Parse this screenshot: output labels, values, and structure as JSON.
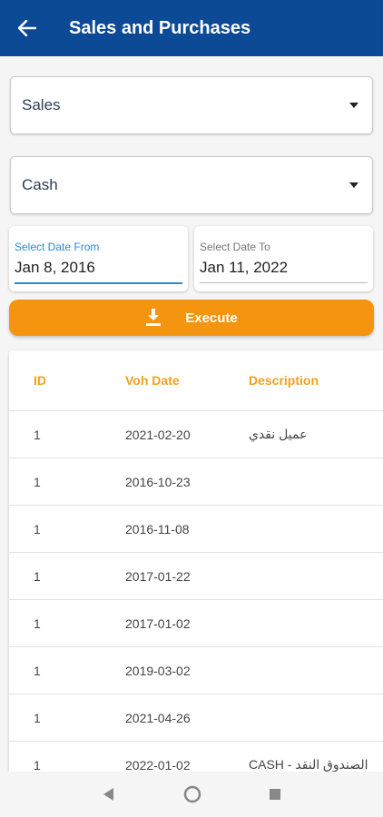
{
  "appbar": {
    "title": "Sales and Purchases"
  },
  "filters": {
    "type_dropdown": "Sales",
    "payment_dropdown": "Cash",
    "date_from": {
      "label": "Select Date From",
      "value": "Jan 8, 2016"
    },
    "date_to": {
      "label": "Select Date To",
      "value": "Jan 11, 2022"
    }
  },
  "execute": {
    "label": "Execute"
  },
  "table": {
    "headers": {
      "id": "ID",
      "date": "Voh Date",
      "desc": "Description"
    },
    "rows": [
      {
        "id": "1",
        "date": "2021-02-20",
        "desc": "عميل نقدي"
      },
      {
        "id": "1",
        "date": "2016-10-23",
        "desc": ""
      },
      {
        "id": "1",
        "date": "2016-11-08",
        "desc": ""
      },
      {
        "id": "1",
        "date": "2017-01-22",
        "desc": ""
      },
      {
        "id": "1",
        "date": "2017-01-02",
        "desc": ""
      },
      {
        "id": "1",
        "date": "2019-03-02",
        "desc": ""
      },
      {
        "id": "1",
        "date": "2021-04-26",
        "desc": ""
      },
      {
        "id": "1",
        "date": "2022-01-02",
        "desc": "CASH - الصندوق النقد"
      }
    ]
  },
  "colors": {
    "primary": "#0d4a96",
    "accent": "#f5940f",
    "header_text": "#f0a020"
  }
}
